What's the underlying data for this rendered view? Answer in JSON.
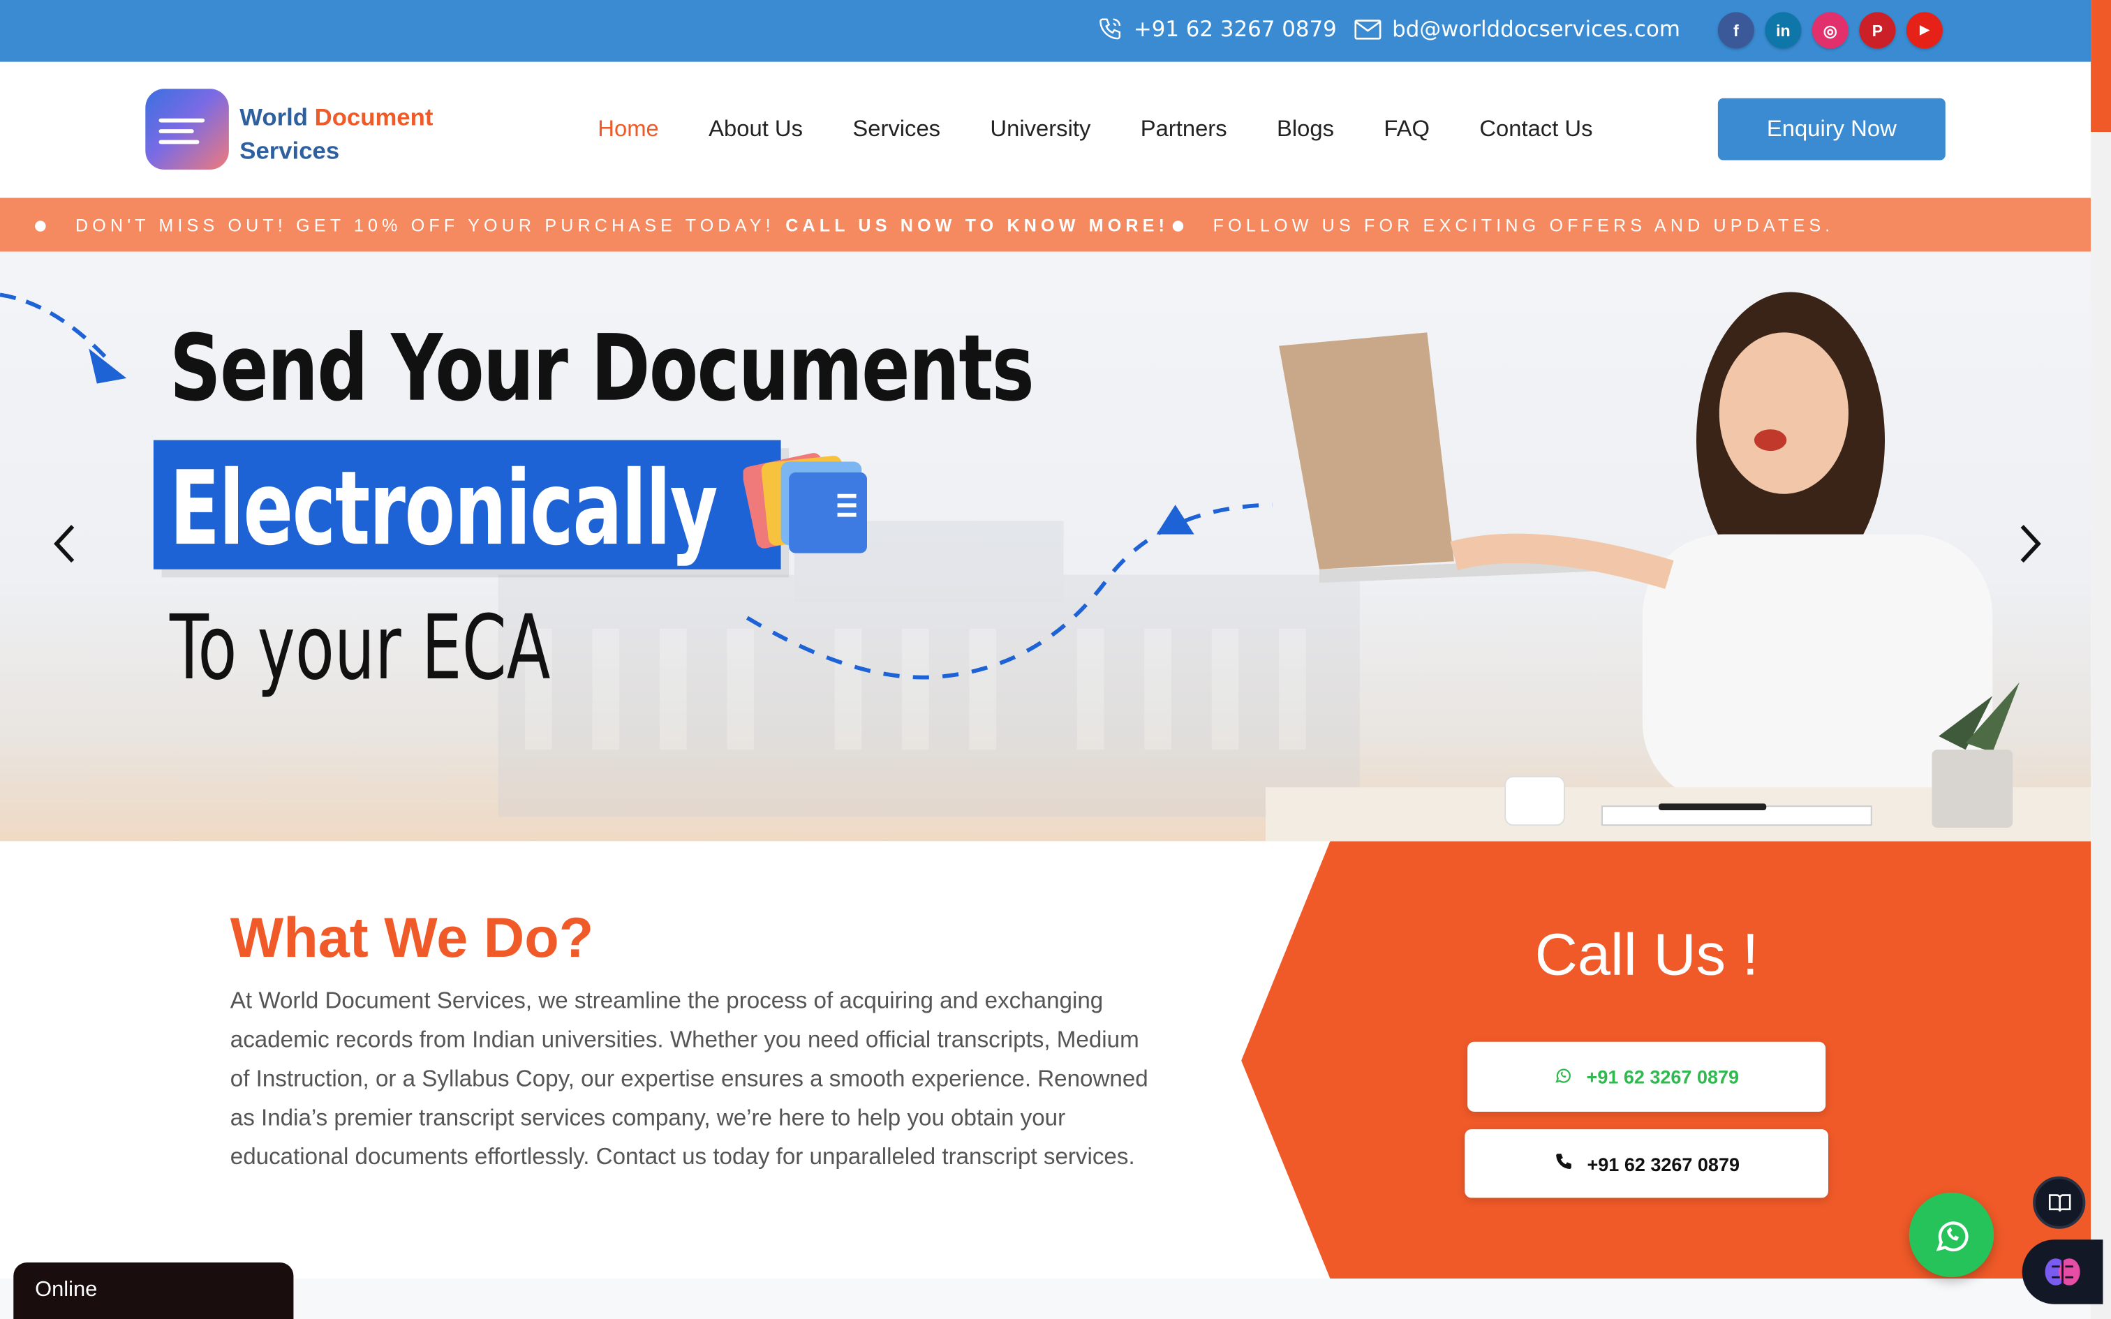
{
  "topbar": {
    "phone": "+91 62 3267 0879",
    "email": "bd@worlddocservices.com",
    "socials": [
      {
        "name": "facebook",
        "glyph": "f",
        "color": "#3b5998"
      },
      {
        "name": "linkedin",
        "glyph": "in",
        "color": "#0e76a8"
      },
      {
        "name": "instagram",
        "glyph": "◎",
        "color": "#e1306c"
      },
      {
        "name": "pinterest",
        "glyph": "P",
        "color": "#cb2027"
      },
      {
        "name": "youtube",
        "glyph": "▶",
        "color": "#e62117"
      }
    ]
  },
  "header": {
    "logo_line1_a": "World ",
    "logo_line1_b": "Document",
    "logo_line2": "Services",
    "nav": [
      "Home",
      "About Us",
      "Services",
      "University",
      "Partners",
      "Blogs",
      "FAQ",
      "Contact Us"
    ],
    "active_nav": "Home",
    "enquiry_label": "Enquiry Now"
  },
  "ticker": {
    "item1_normal": "DON'T MISS OUT! GET 10% OFF YOUR PURCHASE TODAY!",
    "item1_bold": "CALL US NOW TO KNOW MORE!",
    "item2": "FOLLOW US FOR EXCITING OFFERS AND UPDATES."
  },
  "hero": {
    "line1": "Send Your Documents",
    "line2": "Electronically",
    "line3": "To your ECA"
  },
  "what": {
    "title": "What We Do?",
    "body": "At World Document Services, we streamline the process of acquiring and exchanging academic records from Indian universities. Whether you need official transcripts, Medium of Instruction, or a Syllabus Copy, our expertise ensures a smooth experience. Renowned as India’s premier transcript services company, we’re here to help you obtain your educational documents effortlessly. Contact us today for unparalleled transcript services."
  },
  "call": {
    "title": "Call Us !",
    "whatsapp_number": "+91 62 3267 0879",
    "phone_number": "+91 62 3267 0879"
  },
  "widgets": {
    "online_label": "Online"
  },
  "colors": {
    "brand_blue": "#3a8bd1",
    "brand_orange": "#f05a28",
    "ticker": "#f5895f",
    "whatsapp_green": "#25c35a"
  }
}
